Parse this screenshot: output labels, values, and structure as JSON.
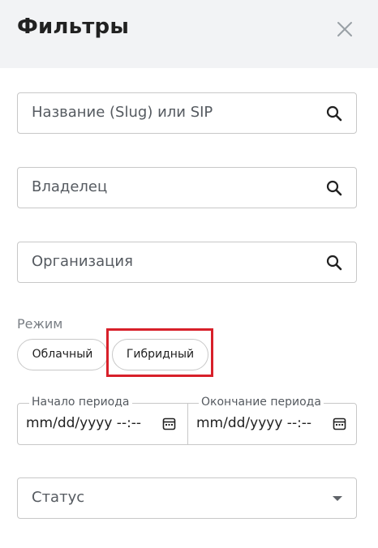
{
  "header": {
    "title": "Фильтры",
    "close_icon": "close-icon"
  },
  "filters": {
    "name_slug_sip": {
      "placeholder": "Название (Slug) или SIP",
      "icon": "search-icon"
    },
    "owner": {
      "placeholder": "Владелец",
      "icon": "search-icon"
    },
    "organization": {
      "placeholder": "Организация",
      "icon": "search-icon"
    }
  },
  "mode": {
    "label": "Режим",
    "options": [
      "Облачный",
      "Гибридный"
    ],
    "highlighted_option": "Гибридный",
    "highlight_color": "#d8202a"
  },
  "period": {
    "start": {
      "label": "Начало периода",
      "value": "mm/dd/yyyy --:--",
      "icon": "calendar-icon"
    },
    "end": {
      "label": "Окончание периода",
      "value": "mm/dd/yyyy --:--",
      "icon": "calendar-icon"
    }
  },
  "status": {
    "placeholder": "Статус",
    "icon": "chevron-down-icon"
  }
}
